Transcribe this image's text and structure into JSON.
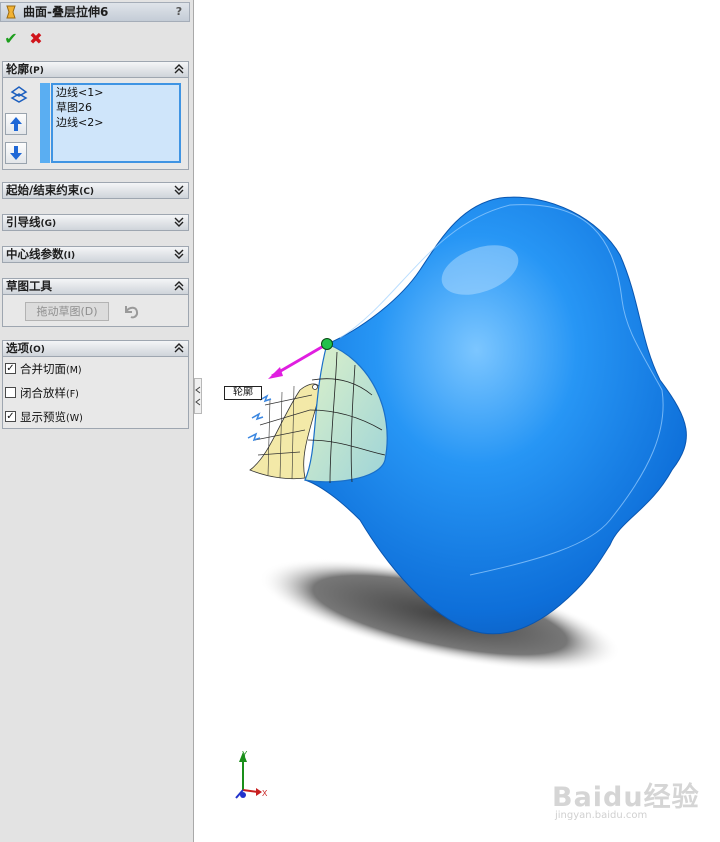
{
  "window": {
    "title": "曲面-叠层拉伸6",
    "help_label": "?"
  },
  "actions": {
    "ok_glyph": "✔",
    "cancel_glyph": "✖"
  },
  "sections": {
    "profiles": {
      "label": "轮廓",
      "shortcut": "(P)",
      "items": [
        "边线<1>",
        "草图26",
        "边线<2>"
      ]
    },
    "start_end": {
      "label": "起始/结束约束",
      "shortcut": "(C)"
    },
    "guides": {
      "label": "引导线",
      "shortcut": "(G)"
    },
    "centerline": {
      "label": "中心线参数",
      "shortcut": "(I)"
    },
    "sketch_tools": {
      "label": "草图工具",
      "drag_label": "拖动草图(D)"
    },
    "options": {
      "label": "选项",
      "shortcut": "(O)",
      "checks": [
        {
          "label": "合并切面",
          "shortcut": "(M)",
          "checked": true,
          "mark": "✓"
        },
        {
          "label": "闭合放样",
          "shortcut": "(F)",
          "checked": false,
          "mark": ""
        },
        {
          "label": "显示预览",
          "shortcut": "(W)",
          "checked": true,
          "mark": "✓"
        }
      ]
    }
  },
  "viewport": {
    "callout": "轮廓",
    "triad": {
      "x": "X",
      "y": "Y"
    },
    "watermark": "Baidu经验",
    "watermark_url": "jingyan.baidu.com"
  },
  "colors": {
    "surface": "#1f8df5",
    "accent": "#3f94e3",
    "preview": "#f3e9a8",
    "handle": "#e01ee0"
  }
}
